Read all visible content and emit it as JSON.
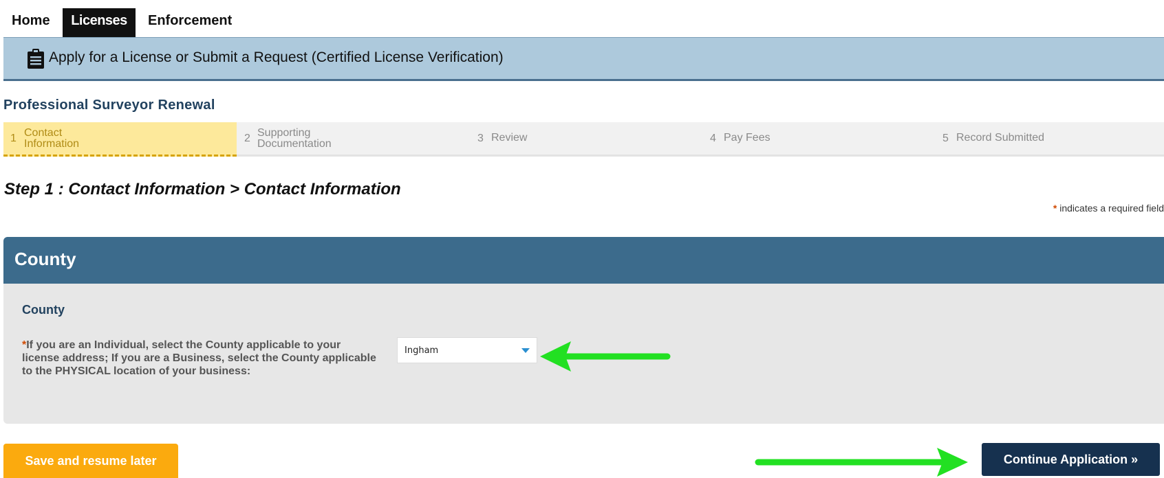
{
  "nav": {
    "tabs": [
      {
        "label": "Home",
        "active": false
      },
      {
        "label": "Licenses",
        "active": true
      },
      {
        "label": "Enforcement",
        "active": false
      }
    ]
  },
  "banner": {
    "icon": "clipboard-icon",
    "title": "Apply for a License or Submit a Request (Certified License Verification)"
  },
  "record_title": "Professional Surveyor Renewal",
  "steps": [
    {
      "num": "1",
      "label": "Contact Information",
      "active": true
    },
    {
      "num": "2",
      "label": "Supporting Documentation",
      "active": false
    },
    {
      "num": "3",
      "label": "Review",
      "active": false
    },
    {
      "num": "4",
      "label": "Pay Fees",
      "active": false
    },
    {
      "num": "5",
      "label": "Record Submitted",
      "active": false
    }
  ],
  "step_heading": "Step 1 : Contact Information > Contact Information",
  "required_note": {
    "star": "*",
    "text": "indicates a required field"
  },
  "section": {
    "title": "County",
    "subtitle": "County",
    "field": {
      "required_star": "*",
      "label": "If you are an Individual, select the County applicable to your license address; If you are a Business, select the County applicable to the PHYSICAL location of your business:",
      "value": "Ingham"
    }
  },
  "buttons": {
    "save": "Save and resume later",
    "continue": "Continue Application »"
  },
  "colors": {
    "banner_bg": "#adc9dc",
    "section_header": "#3c6b8c",
    "active_step": "#fde99b",
    "save_button": "#fbaa0e",
    "continue_button": "#16314f",
    "annotation_arrow": "#22e022"
  }
}
